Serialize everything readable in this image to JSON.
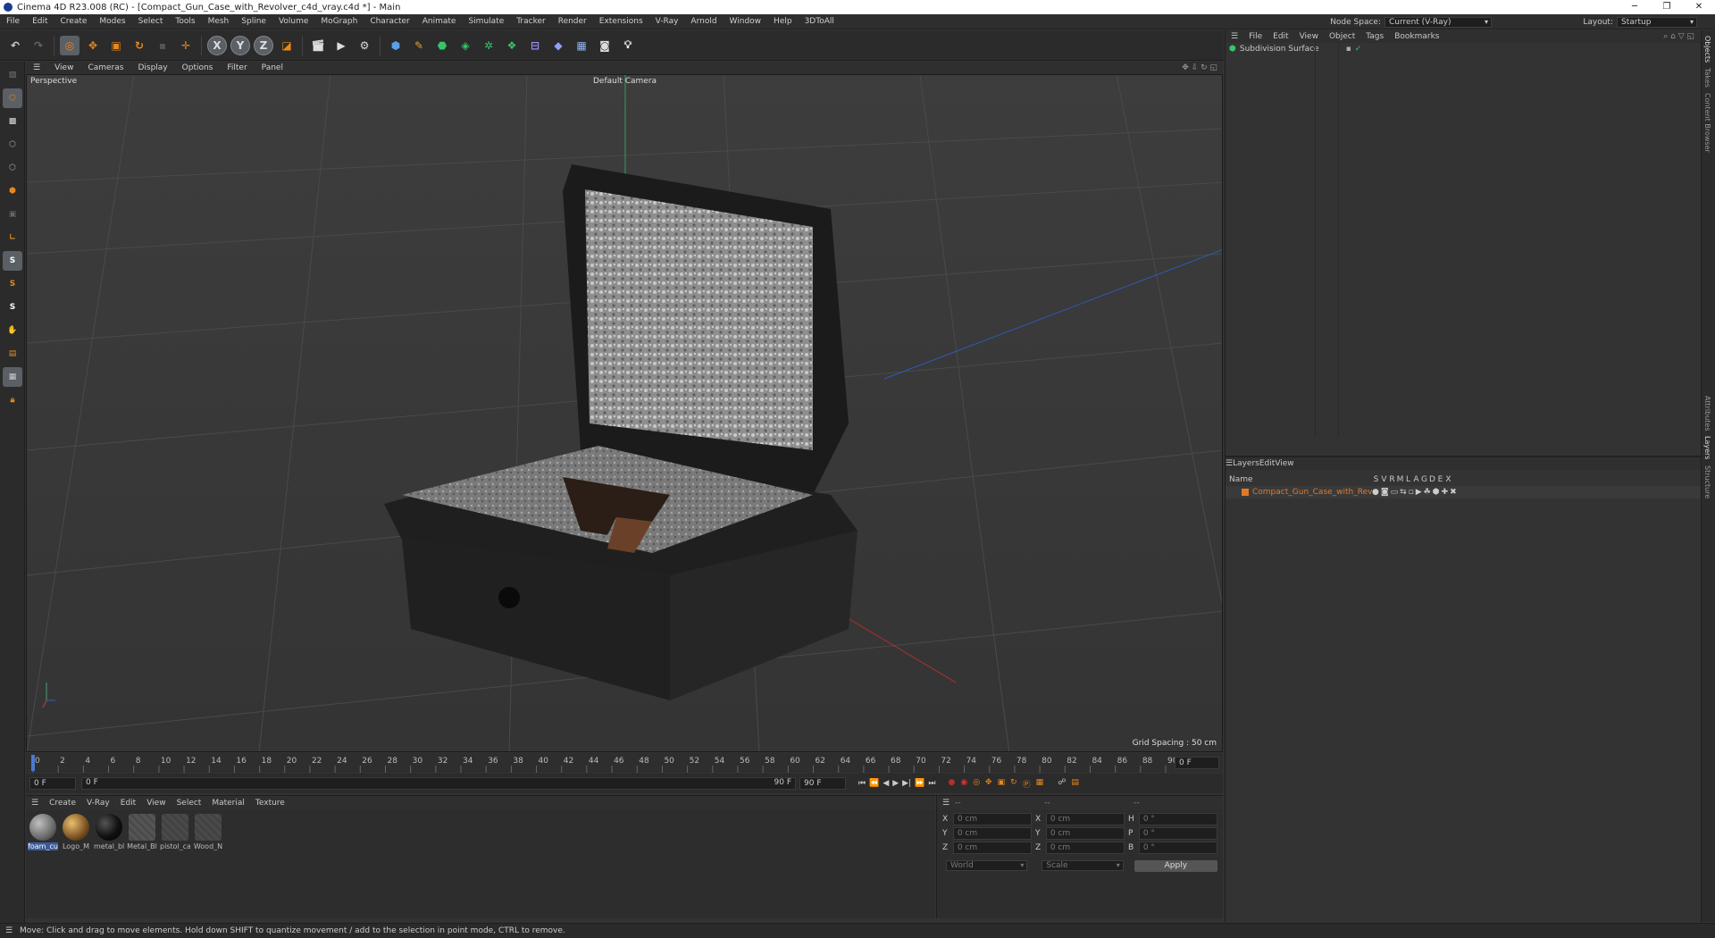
{
  "window": {
    "title": "Cinema 4D R23.008 (RC) - [Compact_Gun_Case_with_Revolver_c4d_vray.c4d *] - Main"
  },
  "menubar": {
    "items": [
      "File",
      "Edit",
      "Create",
      "Modes",
      "Select",
      "Tools",
      "Mesh",
      "Spline",
      "Volume",
      "MoGraph",
      "Character",
      "Animate",
      "Simulate",
      "Tracker",
      "Render",
      "Extensions",
      "V-Ray",
      "Arnold",
      "Window",
      "Help",
      "3DToAll"
    ],
    "node_space_label": "Node Space:",
    "node_space_value": "Current (V-Ray)",
    "layout_label": "Layout:",
    "layout_value": "Startup"
  },
  "viewport": {
    "menu": [
      "View",
      "Cameras",
      "Display",
      "Options",
      "Filter",
      "Panel"
    ],
    "label": "Perspective",
    "camera": "Default Camera",
    "grid_spacing": "Grid Spacing : 50 cm"
  },
  "timeline": {
    "ticks": [
      "0",
      "2",
      "4",
      "6",
      "8",
      "10",
      "12",
      "14",
      "16",
      "18",
      "20",
      "22",
      "24",
      "26",
      "28",
      "30",
      "32",
      "34",
      "36",
      "38",
      "40",
      "42",
      "44",
      "46",
      "48",
      "50",
      "52",
      "54",
      "56",
      "58",
      "60",
      "62",
      "64",
      "66",
      "68",
      "70",
      "72",
      "74",
      "76",
      "78",
      "80",
      "82",
      "84",
      "86",
      "88",
      "90"
    ],
    "current_frame": "0 F",
    "start": "0 F",
    "range_start": "0 F",
    "range_end": "90 F",
    "end": "90 F"
  },
  "materials": {
    "menu": [
      "Create",
      "V-Ray",
      "Edit",
      "View",
      "Select",
      "Material",
      "Texture"
    ],
    "items": [
      {
        "label": "foam_cu",
        "color": "#8a8a8a"
      },
      {
        "label": "Logo_M",
        "color": "#a08040"
      },
      {
        "label": "metal_bl",
        "color": "#151515"
      },
      {
        "label": "Metal_Bl",
        "color": "#555555"
      },
      {
        "label": "pistol_ca",
        "color": "#4a4a4a"
      },
      {
        "label": "Wood_N",
        "color": "#4a4a4a"
      }
    ]
  },
  "coords": {
    "header_left": "--",
    "header_mid": "--",
    "header_right": "--",
    "rows": [
      {
        "a": "X",
        "av": "0 cm",
        "b": "X",
        "bv": "0 cm",
        "c": "H",
        "cv": "0 °"
      },
      {
        "a": "Y",
        "av": "0 cm",
        "b": "Y",
        "bv": "0 cm",
        "c": "P",
        "cv": "0 °"
      },
      {
        "a": "Z",
        "av": "0 cm",
        "b": "Z",
        "bv": "0 cm",
        "c": "B",
        "cv": "0 °"
      }
    ],
    "world": "World",
    "scale": "Scale",
    "apply": "Apply"
  },
  "objects": {
    "menu": [
      "File",
      "Edit",
      "View",
      "Object",
      "Tags",
      "Bookmarks"
    ],
    "items": [
      {
        "name": "Subdivision Surface"
      }
    ]
  },
  "layers": {
    "menu": [
      "Layers",
      "Edit",
      "View"
    ],
    "name_header": "Name",
    "flags": [
      "S",
      "V",
      "R",
      "M",
      "L",
      "A",
      "G",
      "D",
      "E",
      "X"
    ],
    "items": [
      {
        "name": "Compact_Gun_Case_with_Revolver"
      }
    ]
  },
  "side_tabs": [
    "Objects",
    "Takes",
    "Content Browser",
    "Attributes",
    "Layers",
    "Structure"
  ],
  "status": "Move: Click and drag to move elements. Hold down SHIFT to quantize movement / add to the selection in point mode, CTRL to remove.",
  "colors": {
    "accent": "#e8891c",
    "selection": "#5b5f66",
    "layer_orange": "#e07a2a"
  }
}
